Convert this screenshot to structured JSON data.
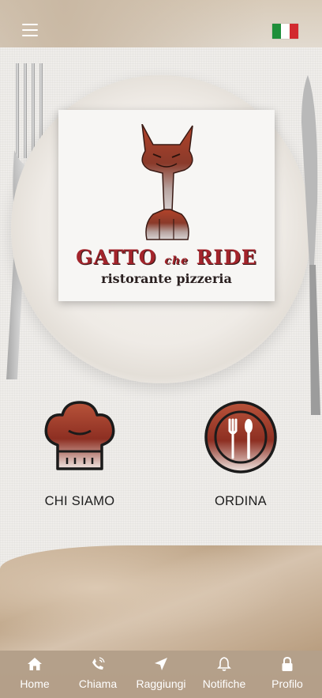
{
  "header": {
    "menu_icon": "hamburger-menu-icon",
    "language_flag": "italy-flag-icon",
    "flag_colors": [
      "#1f8f3a",
      "#ffffff",
      "#d22a2f"
    ]
  },
  "logo": {
    "brand_main_1": "GATTO",
    "brand_small": "che",
    "brand_main_2": "RIDE",
    "tagline": "ristorante pizzeria"
  },
  "actions": [
    {
      "label": "CHI SIAMO",
      "icon": "chef-hat-icon"
    },
    {
      "label": "ORDINA",
      "icon": "fork-spoon-icon"
    }
  ],
  "tabbar": {
    "items": [
      {
        "label": "Home",
        "icon": "home-icon"
      },
      {
        "label": "Chiama",
        "icon": "phone-icon"
      },
      {
        "label": "Raggiungi",
        "icon": "navigation-arrow-icon"
      },
      {
        "label": "Notifiche",
        "icon": "bell-icon"
      },
      {
        "label": "Profilo",
        "icon": "lock-icon"
      }
    ]
  },
  "colors": {
    "accent_red": "#a3242b",
    "tab_bg": "#b29d88"
  }
}
